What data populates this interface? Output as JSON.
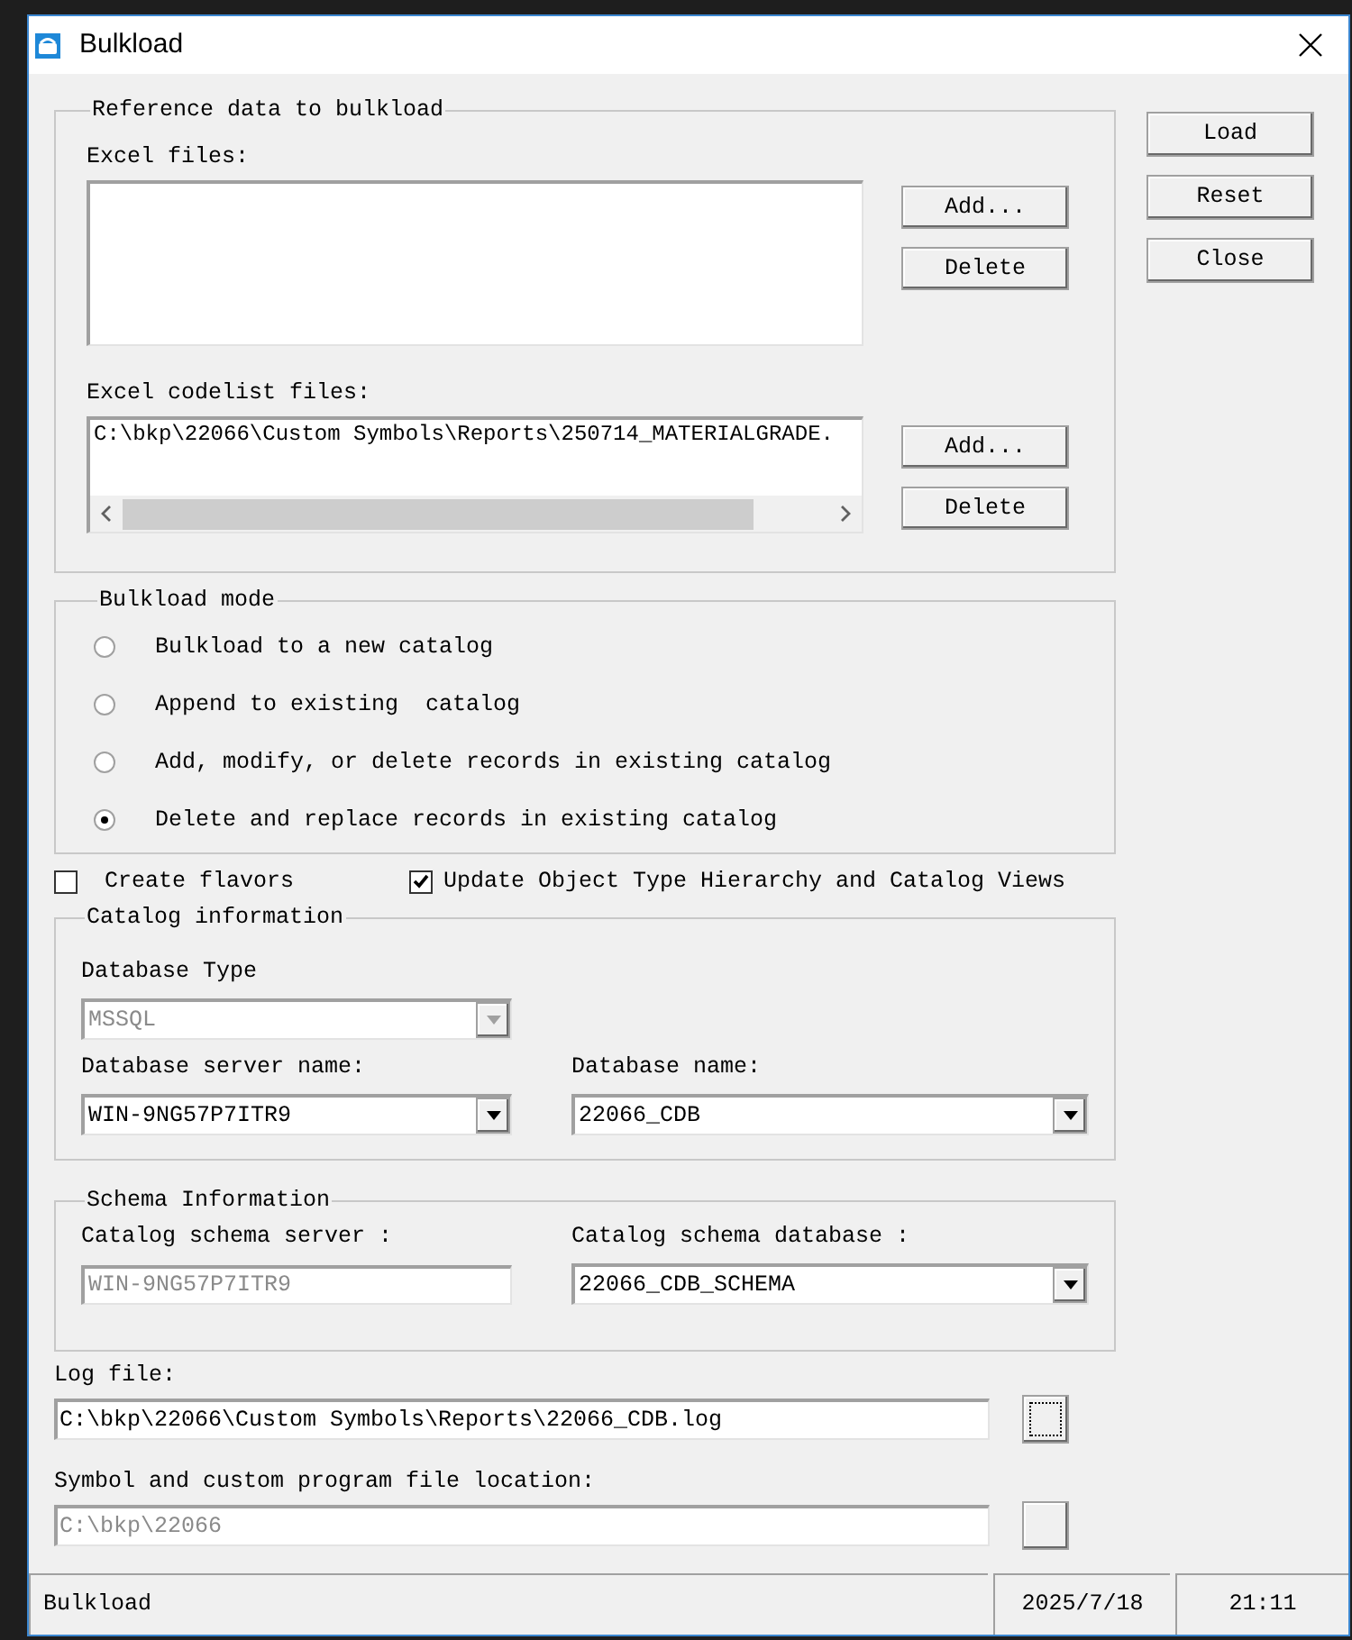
{
  "window": {
    "title": "Bulkload"
  },
  "reference_data": {
    "legend": "Reference data to bulkload",
    "lists": [
      {
        "label": "Excel files:",
        "horizontal_scrollbar": false,
        "buttons": [
          "Add...",
          "Delete"
        ]
      },
      {
        "label": "Excel codelist files:",
        "items": [
          "C:\\bkp\\22066\\Custom Symbols\\Reports\\250714_MATERIALGRADE."
        ],
        "horizontal_scrollbar": true,
        "buttons": [
          "Add...",
          "Delete"
        ]
      }
    ]
  },
  "action_buttons": [
    "Load",
    "Reset",
    "Close"
  ],
  "bulkload_mode": {
    "legend": "Bulkload mode",
    "options": [
      {
        "label": "Bulkload to a new catalog",
        "selected": false
      },
      {
        "label": "Append to existing  catalog",
        "selected": false
      },
      {
        "label": "Add, modify, or delete records in existing catalog",
        "selected": false
      },
      {
        "label": "Delete and replace records in existing catalog",
        "selected": true
      }
    ]
  },
  "options": [
    {
      "label": "Create flavors",
      "checked": false
    },
    {
      "label": "Update Object Type Hierarchy and Catalog Views",
      "checked": true
    }
  ],
  "catalog_information": {
    "legend": "Catalog information",
    "rows": [
      [
        {
          "label": "Database Type",
          "value": "MSSQL",
          "kind": "dropdown",
          "disabled": true
        }
      ],
      [
        {
          "label": "Database server name:",
          "value": "WIN-9NG57P7ITR9",
          "kind": "dropdown",
          "disabled": false
        },
        {
          "label": "Database name:",
          "value": "22066_CDB",
          "kind": "dropdown",
          "disabled": false
        }
      ]
    ]
  },
  "schema_information": {
    "legend": "Schema Information",
    "rows": [
      [
        {
          "label": "Catalog schema server :",
          "value": "WIN-9NG57P7ITR9",
          "kind": "text",
          "disabled": true
        },
        {
          "label": "Catalog schema database :",
          "value": "22066_CDB_SCHEMA",
          "kind": "dropdown",
          "disabled": false
        }
      ]
    ]
  },
  "paths": [
    {
      "label": "Log file:",
      "value": "C:\\bkp\\22066\\Custom Symbols\\Reports\\22066_CDB.log",
      "disabled": false,
      "focused": true
    },
    {
      "label": "Symbol and custom program file location:",
      "value": "C:\\bkp\\22066",
      "disabled": true,
      "focused": false
    }
  ],
  "status_bar": [
    "Bulkload",
    "2025/7/18",
    "21:11"
  ]
}
